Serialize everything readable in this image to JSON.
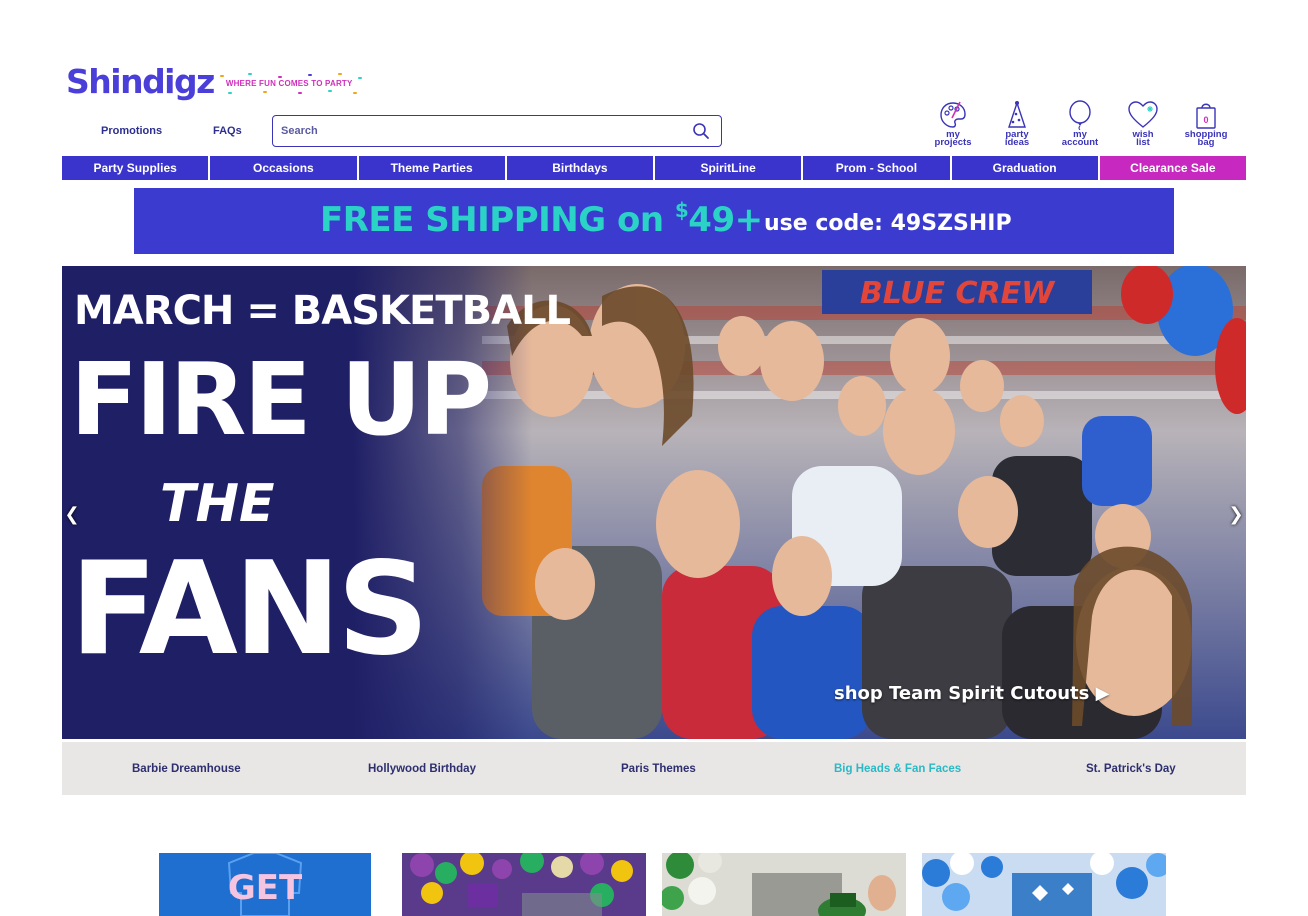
{
  "header": {
    "logo_text": "Shindigz",
    "tagline": "WHERE FUN COMES TO PARTY",
    "links": {
      "promotions": "Promotions",
      "faqs": "FAQs"
    },
    "search": {
      "placeholder": "Search"
    },
    "utility": [
      {
        "label": "my\nprojects",
        "icon": "palette-icon"
      },
      {
        "label": "party\nideas",
        "icon": "party-hat-icon"
      },
      {
        "label": "my\naccount",
        "icon": "balloon-icon"
      },
      {
        "label": "wish\nlist",
        "icon": "heart-icon"
      },
      {
        "label": "shopping\nbag",
        "icon": "bag-icon",
        "count": "0"
      }
    ]
  },
  "nav": {
    "items": [
      "Party Supplies",
      "Occasions",
      "Theme Parties",
      "Birthdays",
      "SpiritLine",
      "Prom - School",
      "Graduation",
      "Clearance Sale"
    ]
  },
  "promo": {
    "main_pre": "FREE SHIPPING on ",
    "currency": "$",
    "amount": "49+",
    "code_text": "use code: 49SZSHIP"
  },
  "hero": {
    "eyebrow": "MARCH = BASKETBALL",
    "line1": "FIRE UP",
    "line2": "THE",
    "line3": "FANS",
    "cta": "shop Team Spirit Cutouts ▶",
    "banner_text": "BLUE CREW"
  },
  "subnav": {
    "items": [
      "Barbie Dreamhouse",
      "Hollywood Birthday",
      "Paris Themes",
      "Big Heads & Fan Faces",
      "St. Patrick's Day"
    ],
    "active_index": 3
  },
  "tiles": {
    "first_text": "GET"
  },
  "colors": {
    "brand_blue": "#3a34cc",
    "sale_pink": "#c728c0",
    "teal": "#2bd2c6",
    "hero_navy": "#1f1f66"
  }
}
